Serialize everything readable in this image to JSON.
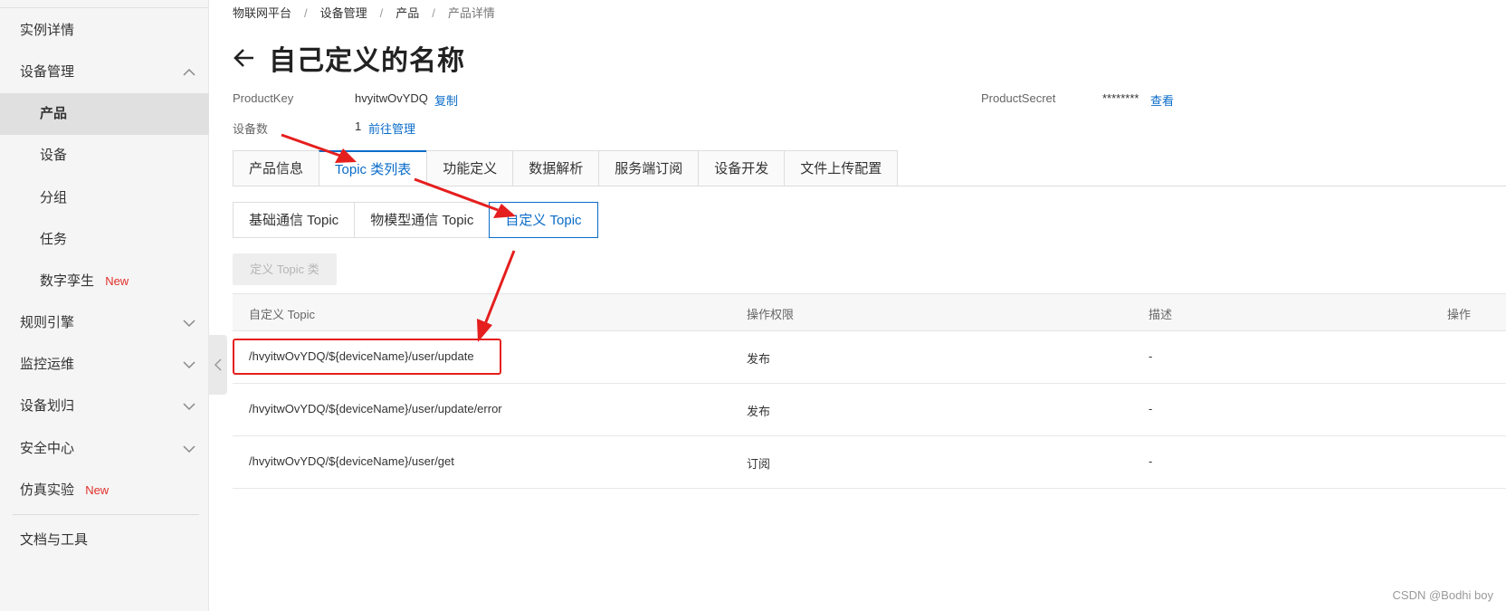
{
  "sidebar": {
    "items": [
      {
        "label": "实例详情",
        "level": 1,
        "chevron": "none"
      },
      {
        "label": "设备管理",
        "level": 1,
        "chevron": "up"
      },
      {
        "label": "产品",
        "level": 2,
        "active": true
      },
      {
        "label": "设备",
        "level": 2
      },
      {
        "label": "分组",
        "level": 2
      },
      {
        "label": "任务",
        "level": 2
      },
      {
        "label": "数字孪生",
        "level": 2,
        "badge": "New"
      },
      {
        "label": "规则引擎",
        "level": 1,
        "chevron": "down"
      },
      {
        "label": "监控运维",
        "level": 1,
        "chevron": "down"
      },
      {
        "label": "设备划归",
        "level": 1,
        "chevron": "down"
      },
      {
        "label": "安全中心",
        "level": 1,
        "chevron": "down"
      },
      {
        "label": "仿真实验",
        "level": 1,
        "badge": "New"
      },
      {
        "label": "文档与工具",
        "level": 1
      }
    ]
  },
  "breadcrumb": [
    "物联网平台",
    "设备管理",
    "产品",
    "产品详情"
  ],
  "page_title": "自己定义的名称",
  "meta": {
    "product_key_label": "ProductKey",
    "product_key_value": "hvyitwOvYDQ",
    "copy_link": "复制",
    "product_secret_label": "ProductSecret",
    "product_secret_value": "********",
    "view_link": "查看",
    "device_count_label": "设备数",
    "device_count_value": "1",
    "manage_link": "前往管理"
  },
  "tabs": [
    {
      "label": "产品信息"
    },
    {
      "label": "Topic 类列表",
      "active": true
    },
    {
      "label": "功能定义"
    },
    {
      "label": "数据解析"
    },
    {
      "label": "服务端订阅"
    },
    {
      "label": "设备开发"
    },
    {
      "label": "文件上传配置"
    }
  ],
  "subtabs": [
    {
      "label": "基础通信 Topic"
    },
    {
      "label": "物模型通信 Topic"
    },
    {
      "label": "自定义 Topic",
      "active": true
    }
  ],
  "define_button": "定义 Topic 类",
  "table": {
    "headers": [
      "自定义 Topic",
      "操作权限",
      "描述",
      "操作"
    ],
    "rows": [
      {
        "topic": "/hvyitwOvYDQ/${deviceName}/user/update",
        "permission": "发布",
        "description": "-"
      },
      {
        "topic": "/hvyitwOvYDQ/${deviceName}/user/update/error",
        "permission": "发布",
        "description": "-"
      },
      {
        "topic": "/hvyitwOvYDQ/${deviceName}/user/get",
        "permission": "订阅",
        "description": "-"
      }
    ]
  },
  "watermark": "CSDN @Bodhi boy",
  "colors": {
    "accent": "#0a6cc9",
    "annotation": "#e51e1e",
    "badge": "#e0302a"
  }
}
